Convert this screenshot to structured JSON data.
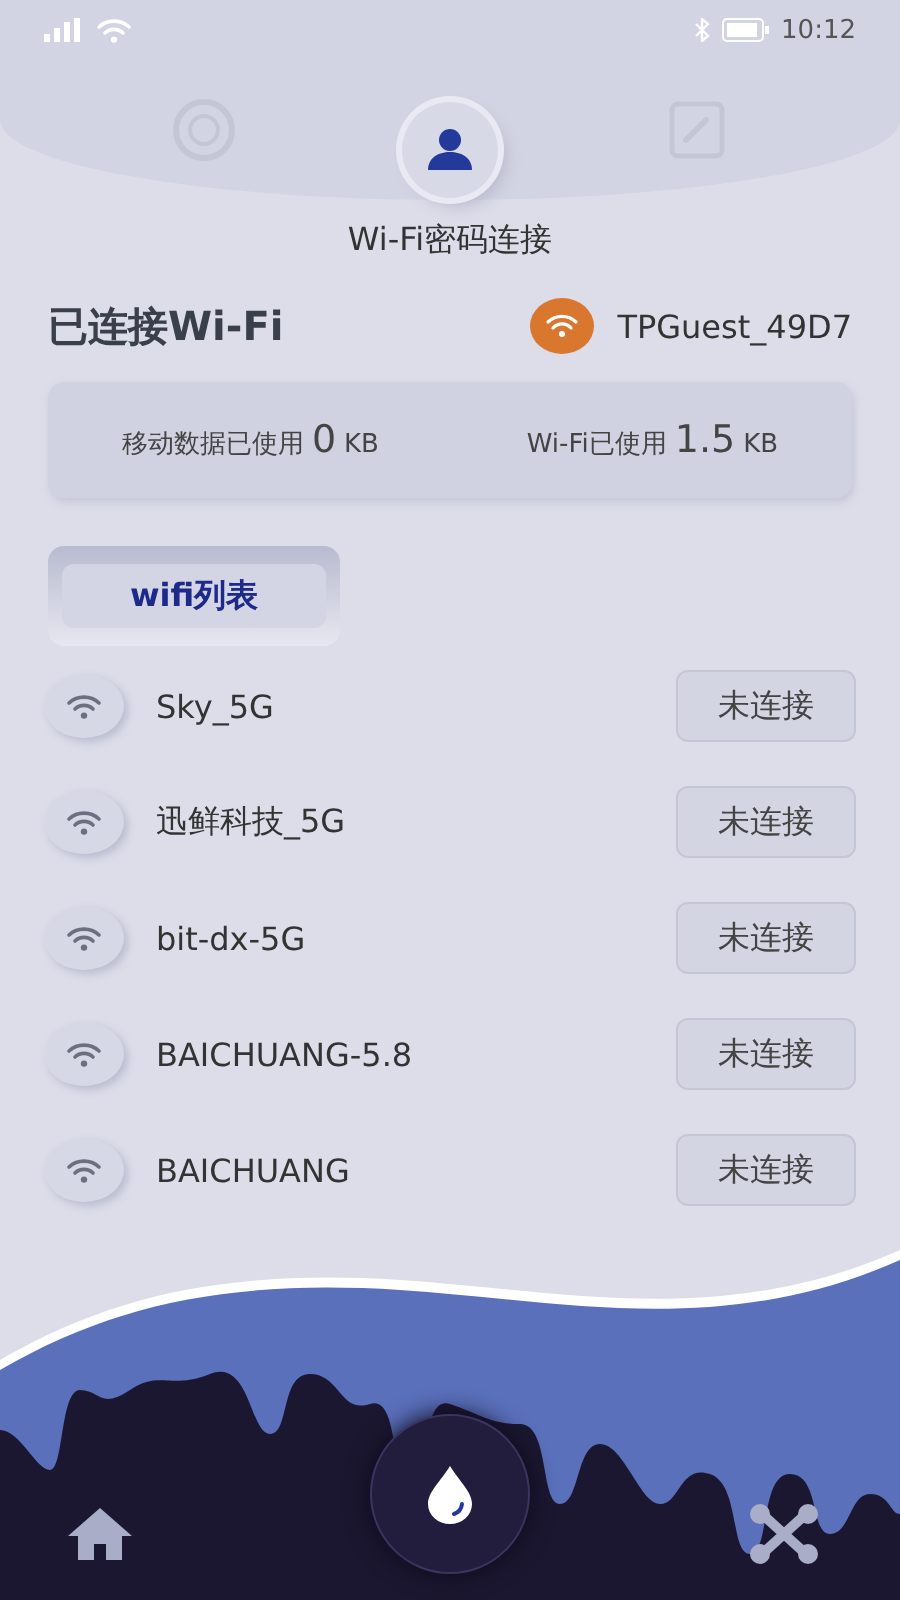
{
  "status_bar": {
    "time": "10:12"
  },
  "top_tabs": [
    {
      "kind": "gauge",
      "selected": false
    },
    {
      "kind": "person",
      "selected": true
    },
    {
      "kind": "notepad",
      "selected": false
    }
  ],
  "title": "Wi-Fi密码连接",
  "connected": {
    "label": "已连接Wi-Fi",
    "ssid": "TPGuest_49D7"
  },
  "usage": [
    {
      "label": "移动数据已使用",
      "value": "0",
      "unit": "KB"
    },
    {
      "label": "Wi-Fi已使用",
      "value": "1.5",
      "unit": "KB"
    }
  ],
  "list_tab": "wifi列表",
  "networks": [
    {
      "name": "Sky_5G",
      "status": "未连接"
    },
    {
      "name": "迅鲜科技_5G",
      "status": "未连接"
    },
    {
      "name": "bit-dx-5G",
      "status": "未连接"
    },
    {
      "name": "BAICHUANG-5.8",
      "status": "未连接"
    },
    {
      "name": "BAICHUANG",
      "status": "未连接"
    }
  ],
  "bottom_nav": [
    {
      "kind": "home",
      "selected": false
    },
    {
      "kind": "drop",
      "selected": true
    },
    {
      "kind": "drone",
      "selected": false
    }
  ]
}
